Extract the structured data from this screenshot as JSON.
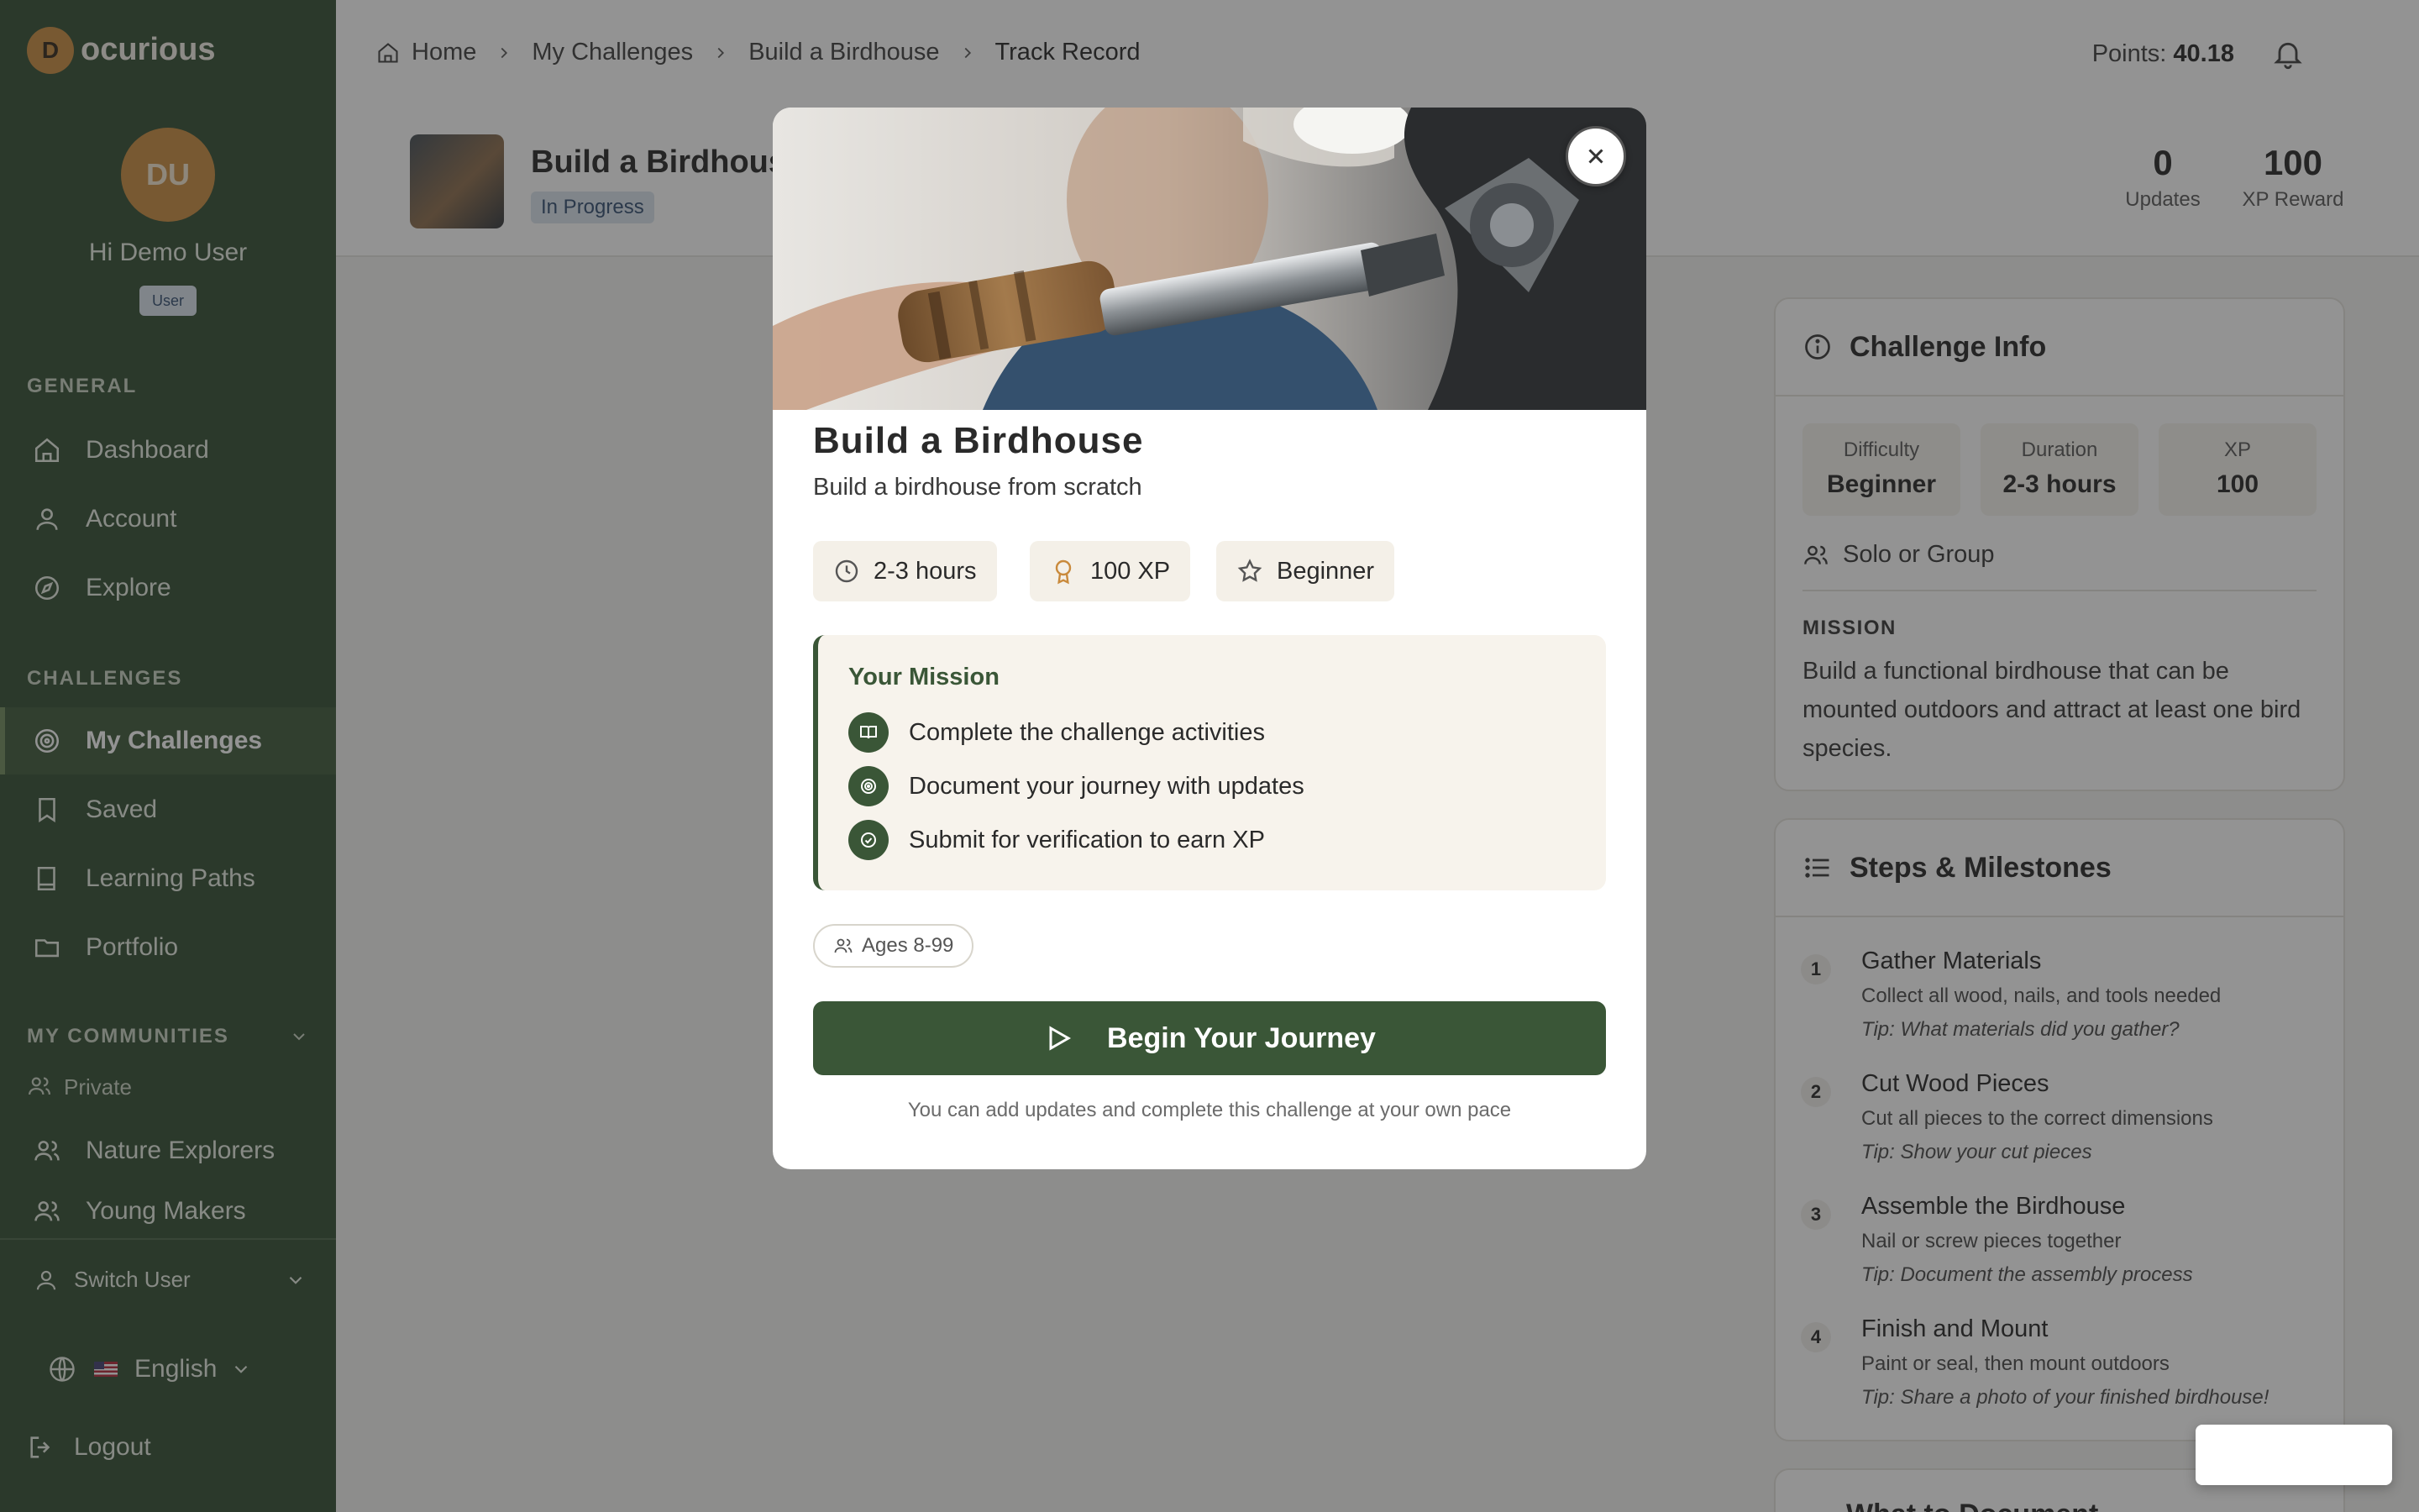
{
  "app": {
    "logo_letter": "D",
    "logo_text": "ocurious"
  },
  "user": {
    "initials": "DU",
    "greeting": "Hi Demo User",
    "role": "User"
  },
  "sidebar": {
    "general_label": "GENERAL",
    "general_items": [
      {
        "label": "Dashboard",
        "icon": "home-icon"
      },
      {
        "label": "Account",
        "icon": "user-icon"
      },
      {
        "label": "Explore",
        "icon": "compass-icon"
      }
    ],
    "challenges_label": "CHALLENGES",
    "challenge_items": [
      {
        "label": "My Challenges",
        "icon": "target-icon",
        "active": true
      },
      {
        "label": "Saved",
        "icon": "bookmark-icon"
      },
      {
        "label": "Learning Paths",
        "icon": "book-icon"
      },
      {
        "label": "Portfolio",
        "icon": "folder-icon"
      }
    ],
    "communities_label": "MY COMMUNITIES",
    "community_private": "Private",
    "community_items": [
      {
        "label": "Nature Explorers",
        "icon": "users-icon"
      },
      {
        "label": "Young Makers",
        "icon": "users-icon"
      }
    ],
    "switch_user": "Switch User",
    "language": "English",
    "logout": "Logout"
  },
  "breadcrumb": [
    "Home",
    "My Challenges",
    "Build a Birdhouse",
    "Track Record"
  ],
  "header": {
    "points_label": "Points:",
    "points_value": "40.18"
  },
  "challenge": {
    "title": "Build a Birdhouse",
    "status": "In Progress",
    "updates_value": "0",
    "updates_label": "Updates",
    "xp_value": "100",
    "xp_label": "XP Reward"
  },
  "info_card": {
    "title": "Challenge Info",
    "difficulty_label": "Difficulty",
    "difficulty_value": "Beginner",
    "duration_label": "Duration",
    "duration_value": "2-3 hours",
    "xp_label": "XP",
    "xp_value": "100",
    "group": "Solo or Group",
    "mission_label": "MISSION",
    "mission_text": "Build a functional birdhouse that can be mounted outdoors and attract at least one bird species."
  },
  "steps_card": {
    "title": "Steps & Milestones",
    "steps": [
      {
        "n": "1",
        "title": "Gather Materials",
        "desc": "Collect all wood, nails, and tools needed",
        "tip": "Tip: What materials did you gather?"
      },
      {
        "n": "2",
        "title": "Cut Wood Pieces",
        "desc": "Cut all pieces to the correct dimensions",
        "tip": "Tip: Show your cut pieces"
      },
      {
        "n": "3",
        "title": "Assemble the Birdhouse",
        "desc": "Nail or screw pieces together",
        "tip": "Tip: Document the assembly process"
      },
      {
        "n": "4",
        "title": "Finish and Mount",
        "desc": "Paint or seal, then mount outdoors",
        "tip": "Tip: Share a photo of your finished birdhouse!"
      }
    ],
    "next_title": "What to Document"
  },
  "modal": {
    "title": "Build a Birdhouse",
    "subtitle": "Build a birdhouse from scratch",
    "chips": [
      {
        "label": "2-3 hours",
        "icon": "clock-icon"
      },
      {
        "label": "100 XP",
        "icon": "award-icon"
      },
      {
        "label": "Beginner",
        "icon": "star-icon"
      }
    ],
    "mission_title": "Your Mission",
    "mission_items": [
      {
        "label": "Complete the challenge activities",
        "icon": "book-open-icon"
      },
      {
        "label": "Document your journey with updates",
        "icon": "target-icon"
      },
      {
        "label": "Submit for verification to earn XP",
        "icon": "check-circle-icon"
      }
    ],
    "ages": "Ages 8-99",
    "begin_label": "Begin Your Journey",
    "note": "You can add updates and complete this challenge at your own pace"
  },
  "colors": {
    "brand_green": "#3a5637",
    "sidebar_bg": "#2f4a2f",
    "accent_orange": "#c98a3c"
  }
}
